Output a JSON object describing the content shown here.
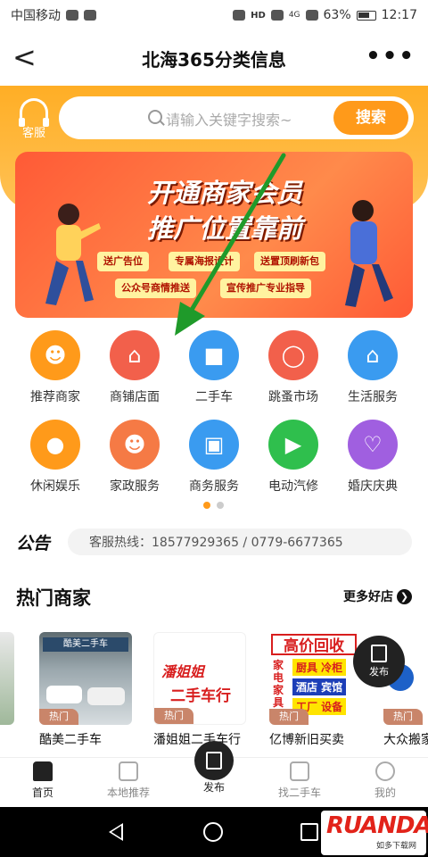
{
  "status_bar": {
    "carrier": "中国移动",
    "network": "4G",
    "battery": "63%",
    "time": "12:17",
    "hd": "HD"
  },
  "navbar": {
    "back": "<",
    "title": "北海365分类信息",
    "more": "•••"
  },
  "header": {
    "service_label": "客服",
    "search_placeholder": "请输入关键字搜索~",
    "search_button": "搜索"
  },
  "banner": {
    "title_line1": "开通商家会员",
    "title_line2": "推广位置靠前",
    "tags": [
      "送广告位",
      "专属海报设计",
      "送置顶刷新包",
      "公众号商情推送",
      "宣传推广专业指导"
    ]
  },
  "categories": [
    {
      "label": "推荐商家",
      "color": "#ff9a1a",
      "icon": "person-icon"
    },
    {
      "label": "商铺店面",
      "color": "#f2604b",
      "icon": "store-icon"
    },
    {
      "label": "二手车",
      "color": "#3a9bf0",
      "icon": "car-icon"
    },
    {
      "label": "跳蚤市场",
      "color": "#f2604b",
      "icon": "basket-icon"
    },
    {
      "label": "生活服务",
      "color": "#3a9bf0",
      "icon": "house-icon"
    },
    {
      "label": "休闲娱乐",
      "color": "#ff9a1a",
      "icon": "gamepad-icon"
    },
    {
      "label": "家政服务",
      "color": "#f57a45",
      "icon": "housekeeper-icon"
    },
    {
      "label": "商务服务",
      "color": "#3a9bf0",
      "icon": "briefcase-icon"
    },
    {
      "label": "电动汽修",
      "color": "#2fbf4d",
      "icon": "scooter-icon"
    },
    {
      "label": "婚庆庆典",
      "color": "#a05fe0",
      "icon": "balloon-icon"
    }
  ],
  "notice": {
    "logo": "公告",
    "text": "客服热线：18577929365 / 0779-6677365"
  },
  "hot_section": {
    "title": "热门商家",
    "more": "更多好店"
  },
  "merchants": [
    {
      "name": "酷美二手车",
      "badge": "热门",
      "img_text": "酷美二手车"
    },
    {
      "name": "潘姐姐二手车行",
      "badge": "热门",
      "img_text": "潘姐姐",
      "img_sub": "二手车行"
    },
    {
      "name": "亿博新旧买卖",
      "badge": "热门",
      "img_text": "高价回收",
      "img_lines": [
        "厨具 冷柜",
        "酒店 宾馆",
        "工厂 设备"
      ],
      "img_side": "家电家具"
    },
    {
      "name": "大众搬家",
      "badge": "热门"
    }
  ],
  "publish_float": {
    "label": "发布"
  },
  "tabs": [
    {
      "label": "首页"
    },
    {
      "label": "本地推荐"
    },
    {
      "label": "发布"
    },
    {
      "label": "找二手车"
    },
    {
      "label": "我的"
    }
  ],
  "watermark": {
    "text": "RUANDAO",
    "sub": "如多下载网"
  }
}
